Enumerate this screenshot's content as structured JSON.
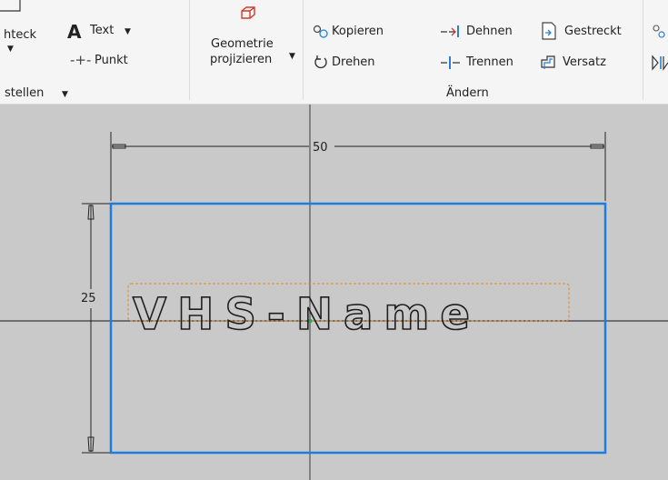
{
  "ribbon": {
    "rect_partial": "hteck",
    "text_label": "Text",
    "point_label": "Punkt",
    "panel_create_label": "stellen",
    "geometry_line1": "Geometrie",
    "geometry_line2": "projizieren",
    "copy_label": "Kopieren",
    "rotate_label": "Drehen",
    "stretch_label": "Dehnen",
    "split_label": "Trennen",
    "straight_label": "Gestreckt",
    "offset_label": "Versatz",
    "panel_modify_label": "Ändern"
  },
  "sketch": {
    "width_dimension": "50",
    "height_dimension": "25",
    "text": "VHS-Name"
  },
  "colors": {
    "selection_blue": "#1e7be0",
    "text_frame_orange": "#e08a2a",
    "canvas_gray": "#c9c9c9"
  }
}
